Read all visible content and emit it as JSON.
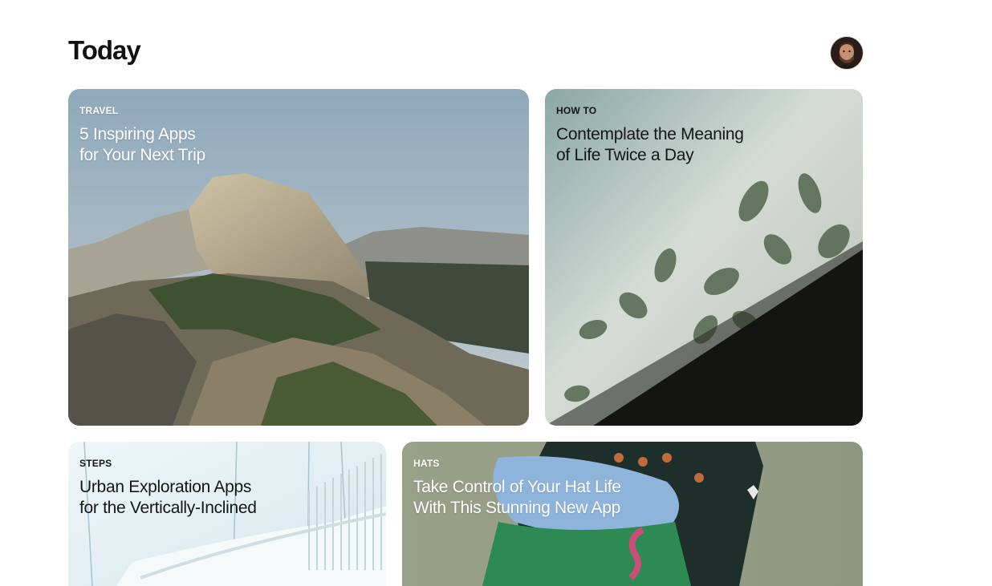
{
  "header": {
    "title": "Today",
    "avatar_icon": "profile-avatar-icon"
  },
  "cards": [
    {
      "category": "TRAVEL",
      "title": "5 Inspiring Apps\nfor Your Next Trip",
      "text_color": "#ffffff"
    },
    {
      "category": "HOW TO",
      "title": "Contemplate the Meaning\nof Life Twice a Day",
      "text_color": "#151515"
    },
    {
      "category": "STEPS",
      "title": "Urban Exploration Apps\nfor the Vertically-Inclined",
      "text_color": "#151515"
    },
    {
      "category": "HATS",
      "title": "Take Control of Your Hat Life\nWith This Stunning New App",
      "text_color": "#ffffff"
    }
  ]
}
